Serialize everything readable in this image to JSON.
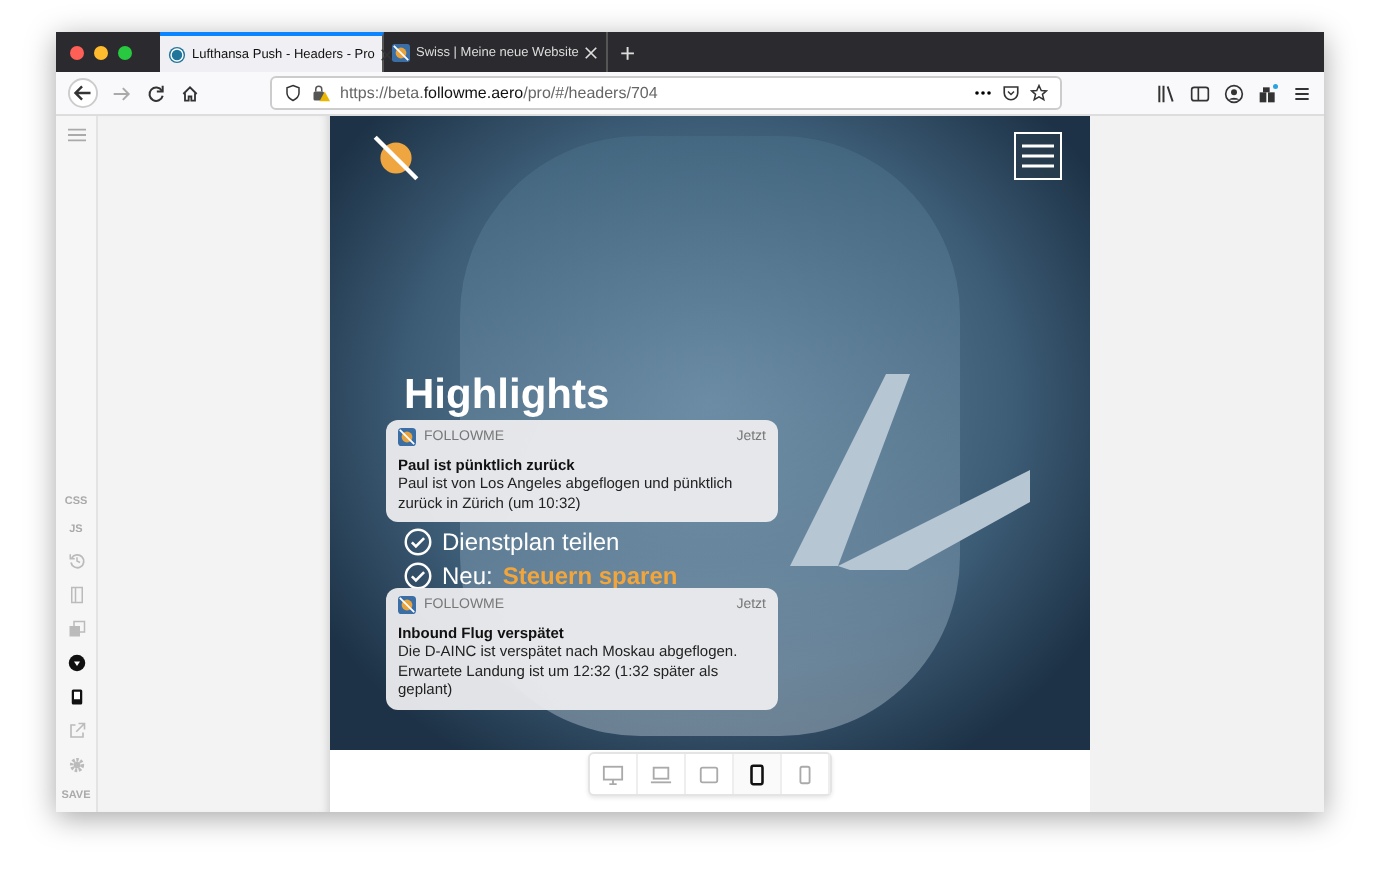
{
  "browser": {
    "tabs": [
      {
        "title": "Lufthansa Push - Headers - Pro",
        "selected": true
      },
      {
        "title": "Swiss | Meine neue Website",
        "selected": false
      }
    ],
    "new_tab": "+",
    "url": "https://beta.**followme.aero**/pro/#/headers/704",
    "forward_disabled": true
  },
  "editor_sidebar": [
    {
      "kind": "menu",
      "active": false
    },
    {
      "kind": "text",
      "label": "CSS",
      "active": false
    },
    {
      "kind": "text",
      "label": "JS",
      "active": false
    },
    {
      "kind": "icon",
      "active": false
    },
    {
      "kind": "icon",
      "active": false
    },
    {
      "kind": "icon",
      "active": false
    },
    {
      "kind": "icon",
      "active": true
    },
    {
      "kind": "icon",
      "active": true
    },
    {
      "kind": "icon",
      "active": false
    },
    {
      "kind": "icon",
      "active": false
    },
    {
      "kind": "text",
      "label": "SAVE",
      "active": false
    }
  ],
  "preview": {
    "heading": "Highlights",
    "checklist": [
      {
        "label": "Dienstplan teilen",
        "checked": true
      },
      {
        "label": "Steuern sparen",
        "checked": true,
        "prefix": "Neu:"
      }
    ],
    "notifications": [
      {
        "app": "FOLLOWME",
        "time": "Jetzt",
        "title": "Paul ist pünktlich zurück",
        "body": "Paul ist von Los Angeles abgeflogen und pünktlich zurück in Zürich (um 10:32)"
      },
      {
        "app": "FOLLOWME",
        "time": "Jetzt",
        "title": "Inbound Flug verspätet",
        "body": "Die D-AINC ist verspätet nach Moskau abgeflogen. Erwartete Landung ist um 12:32 (1:32 später als geplant)"
      }
    ]
  },
  "device_switcher": [
    {
      "selected": false
    },
    {
      "selected": false
    },
    {
      "selected": false
    },
    {
      "selected": true
    },
    {
      "selected": false
    }
  ]
}
